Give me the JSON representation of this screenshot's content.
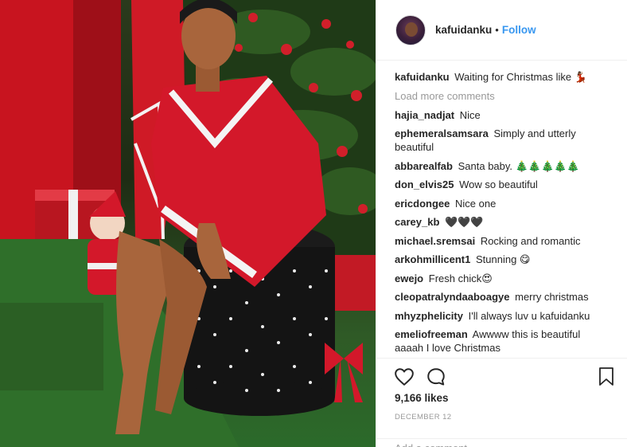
{
  "post": {
    "username": "kafuidanku",
    "follow_label": "Follow",
    "caption": {
      "user": "kafuidanku",
      "text": "Waiting for Christmas like 💃🏾"
    },
    "load_more": "Load more comments",
    "comments": [
      {
        "user": "hajia_nadjat",
        "text": "Nice"
      },
      {
        "user": "ephemeralsamsara",
        "text": "Simply and utterly beautiful"
      },
      {
        "user": "abbarealfab",
        "text": "Santa baby. 🎄🎄🎄🎄🎄"
      },
      {
        "user": "don_elvis25",
        "text": "Wow so beautiful"
      },
      {
        "user": "ericdongee",
        "text": "Nice one"
      },
      {
        "user": "carey_kb",
        "text": "🖤🖤🖤"
      },
      {
        "user": "michael.sremsai",
        "text": "Rocking and romantic"
      },
      {
        "user": "arkohmillicent1",
        "text": "Stunning 😋"
      },
      {
        "user": "ewejo",
        "text": "Fresh chick😍"
      },
      {
        "user": "cleopatralyndaaboagye",
        "text": "merry christmas"
      },
      {
        "user": "mhyzphelicity",
        "text": "I'll always luv u kafuidanku"
      },
      {
        "user": "emeliofreeman",
        "text": "Awwww this is beautiful aaaah I love Christmas"
      }
    ],
    "likes": "9,166 likes",
    "date": "DECEMBER 12",
    "add_comment": "Add a comment..."
  },
  "colors": {
    "link_blue": "#3897f0",
    "muted_gray": "#999999",
    "santa_red": "#d3182a"
  },
  "icons": [
    "heart-icon",
    "comment-icon",
    "bookmark-icon"
  ]
}
